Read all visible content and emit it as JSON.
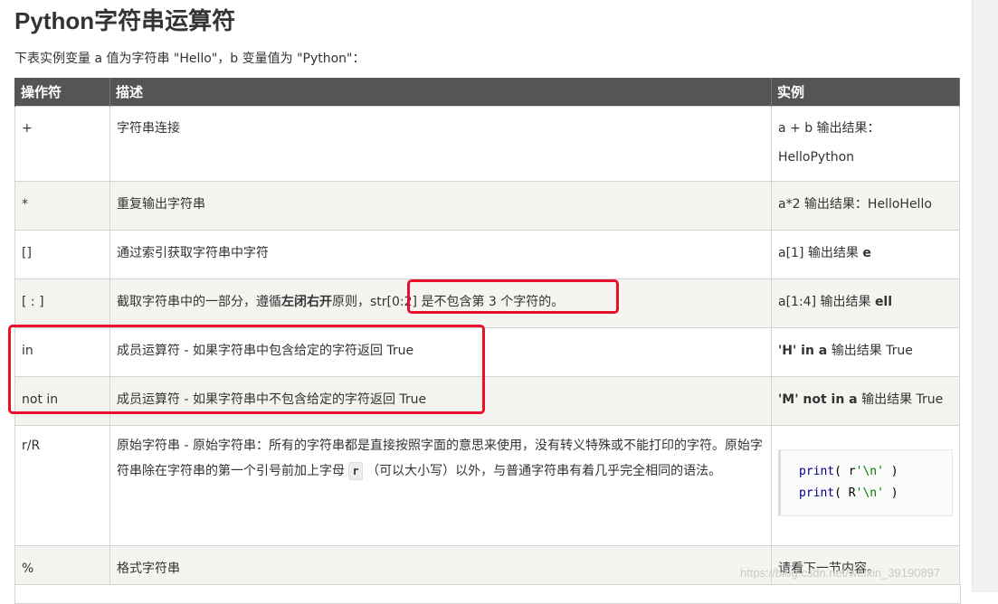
{
  "page": {
    "title": "Python字符串运算符",
    "intro": "下表实例变量 a 值为字符串 \"Hello\"，b 变量值为 \"Python\"："
  },
  "table": {
    "headers": [
      "操作符",
      "描述",
      "实例"
    ],
    "rows": [
      {
        "op": "+",
        "desc": "字符串连接",
        "ex_line1": "a + b 输出结果：",
        "ex_line2": "HelloPython"
      },
      {
        "op": "*",
        "desc": "重复输出字符串",
        "ex": "a*2 输出结果：HelloHello"
      },
      {
        "op": "[]",
        "desc": "通过索引获取字符串中字符",
        "ex_prefix": "a[1] 输出结果 ",
        "ex_bold": "e"
      },
      {
        "op": "[ : ]",
        "desc_pre": "截取字符串中的一部分，遵循",
        "desc_bold": "左闭右开",
        "desc_mid": "原则，",
        "desc_highlight": "str[0:2] 是不包含第 3 个字符的。",
        "ex_prefix": "a[1:4] 输出结果 ",
        "ex_bold": "ell"
      },
      {
        "op": "in",
        "desc": "成员运算符 - 如果字符串中包含给定的字符返回 True",
        "ex_bold": "'H' in a",
        "ex_suffix": " 输出结果 True"
      },
      {
        "op": "not in",
        "desc": "成员运算符 - 如果字符串中不包含给定的字符返回 True",
        "ex_bold": "'M' not in a",
        "ex_suffix": " 输出结果 True"
      },
      {
        "op": "r/R",
        "desc_pre": "原始字符串 - 原始字符串：所有的字符串都是直接按照字面的意思来使用，没有转义特殊或不能打印的字符。原始字符串除在字符串的第一个引号前加上字母 ",
        "desc_kbd": "r",
        "desc_post": " （可以大小写）以外，与普通字符串有着几乎完全相同的语法。",
        "code_lines": [
          {
            "fn": "print",
            "open": "( r",
            "str": "'\\n'",
            "close": " )"
          },
          {
            "fn": "print",
            "open": "( R",
            "str": "'\\n'",
            "close": " )"
          }
        ]
      },
      {
        "op": "%",
        "desc": "格式字符串",
        "ex": "请看下一节内容。"
      }
    ]
  },
  "watermark": "https://blog.csdn.net/weixin_39190897",
  "colors": {
    "header_bg": "#555555",
    "highlight_border": "#e8102a",
    "row_alt_bg": "#f6f4f0"
  }
}
